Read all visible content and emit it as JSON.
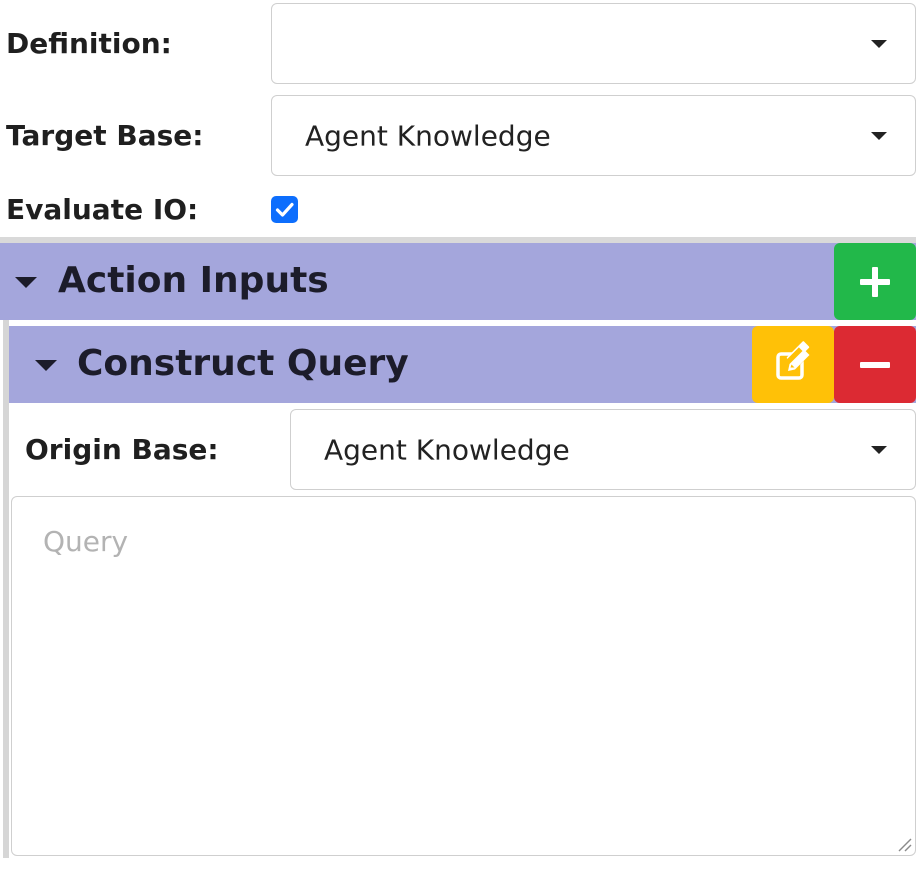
{
  "definition": {
    "label": "Definition:",
    "value": ""
  },
  "target_base": {
    "label": "Target Base:",
    "value": "Agent Knowledge"
  },
  "evaluate_io": {
    "label": "Evaluate IO:",
    "checked": true
  },
  "action_inputs": {
    "title": "Action Inputs",
    "add_icon": "plus-icon"
  },
  "construct_query": {
    "title": "Construct Query",
    "edit_icon": "edit-icon",
    "remove_icon": "minus-icon",
    "origin_base": {
      "label": "Origin Base:",
      "value": "Agent Knowledge"
    },
    "query": {
      "placeholder": "Query",
      "value": ""
    }
  },
  "colors": {
    "header_bg": "#a4a6dc",
    "add_button": "#22b84a",
    "edit_button": "#ffc107",
    "remove_button": "#dc2a33",
    "checkbox": "#0d6efd"
  }
}
